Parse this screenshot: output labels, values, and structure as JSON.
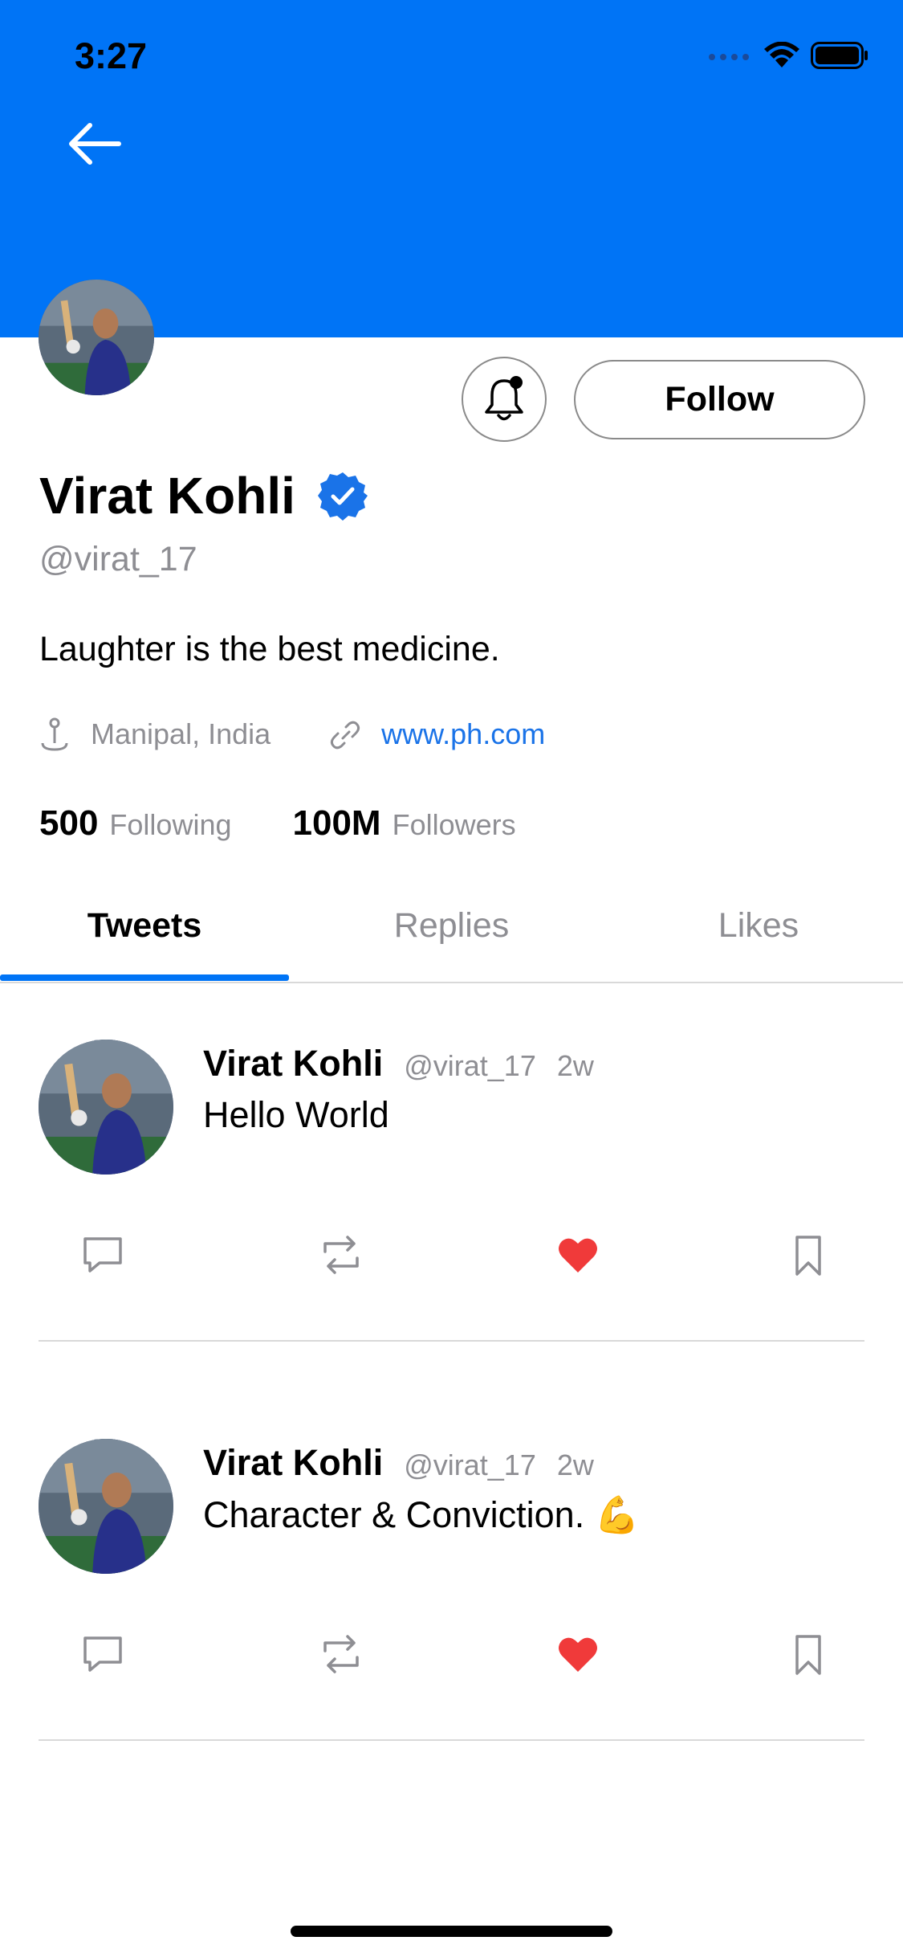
{
  "status_bar": {
    "time": "3:27"
  },
  "profile": {
    "name": "Virat Kohli",
    "handle": "@virat_17",
    "bio": "Laughter is the best medicine.",
    "location": "Manipal, India",
    "website": "www.ph.com",
    "verified": true,
    "following_count": "500",
    "following_label": "Following",
    "followers_count": "100M",
    "followers_label": "Followers"
  },
  "actions": {
    "follow_label": "Follow"
  },
  "tabs": [
    {
      "label": "Tweets",
      "active": true
    },
    {
      "label": "Replies",
      "active": false
    },
    {
      "label": "Likes",
      "active": false
    }
  ],
  "tweets": [
    {
      "name": "Virat Kohli",
      "handle": "@virat_17",
      "time": "2w",
      "text": "Hello World",
      "liked": true
    },
    {
      "name": "Virat Kohli",
      "handle": "@virat_17",
      "time": "2w",
      "text": "Character & Conviction. 💪",
      "liked": true
    }
  ],
  "colors": {
    "brand_blue": "#0074F6",
    "link_blue": "#1a73e8",
    "like_red": "#F03A3A",
    "muted_gray": "#8e8e93"
  },
  "icons": {
    "back": "arrow-left-icon",
    "notifications": "bell-icon",
    "verified": "verified-badge-icon",
    "location": "location-pin-icon",
    "website": "link-icon",
    "reply": "comment-icon",
    "retweet": "retweet-icon",
    "like": "heart-icon",
    "bookmark": "bookmark-icon"
  }
}
